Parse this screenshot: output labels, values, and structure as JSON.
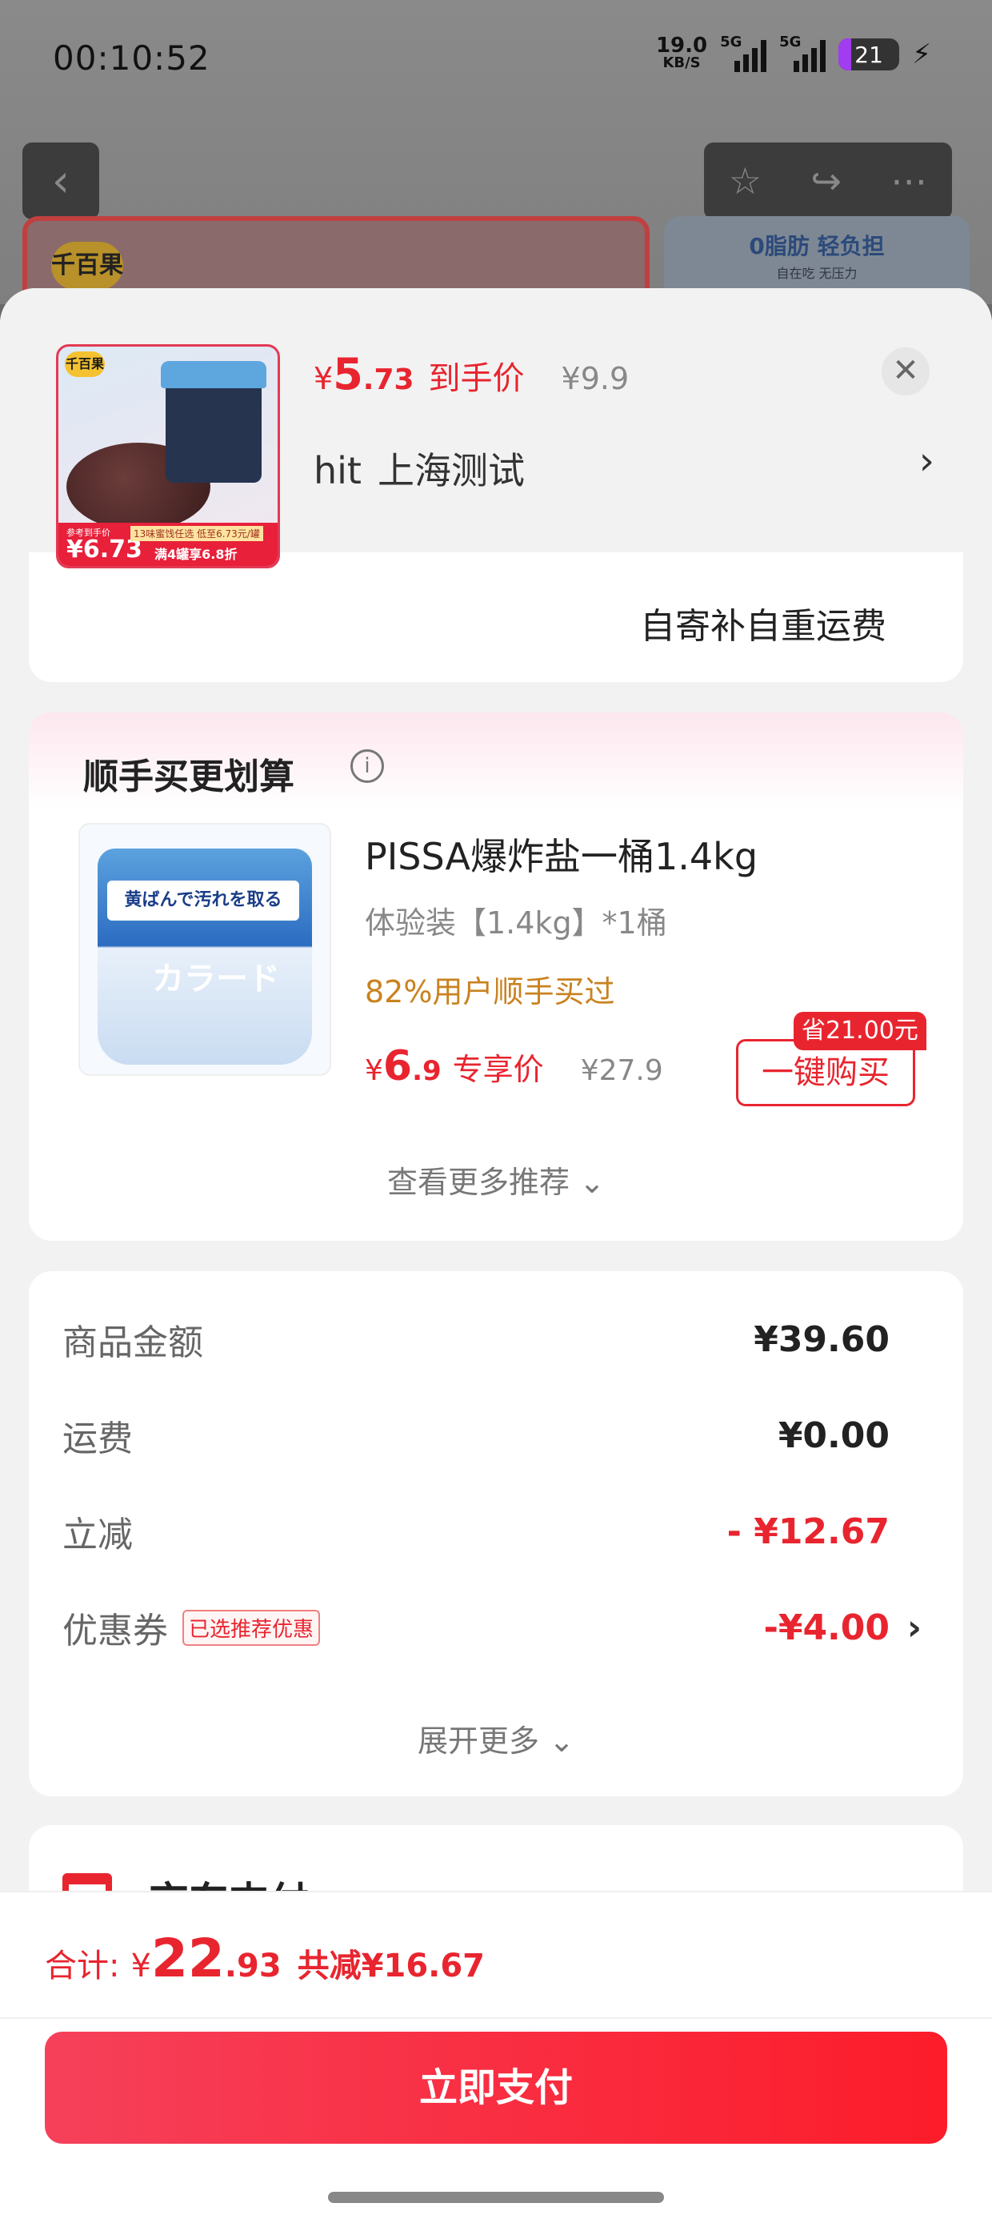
{
  "status_bar": {
    "time": "00:10:52",
    "net_speed": "19.0",
    "net_unit": "KB/S",
    "signal1": "5G",
    "signal2": "5G",
    "battery": "21"
  },
  "background": {
    "card_right_title": "0脂肪 轻负担",
    "card_right_sub": "自在吃 无压力",
    "logo": "千百果"
  },
  "sheet_header": {
    "price_currency": "¥",
    "price_int": "5",
    "price_dec": ".73",
    "price_label": "到手价",
    "orig_price": "¥9.9",
    "address_name": "hit",
    "address_region": "上海测试",
    "thumb_badge_label": "参考到手价",
    "thumb_badge_price": "¥6.73",
    "thumb_badge_small": "13味蜜饯任选 低至6.73元/罐",
    "thumb_badge_deal": "满4罐享6.8折"
  },
  "shipping_clip": "自寄补自重运费",
  "addon": {
    "title": "顺手买更划算",
    "product_name": "PISSA爆炸盐一桶1.4kg",
    "product_spec": "体验装【1.4kg】*1桶",
    "product_stat": "82%用户顺手买过",
    "price_currency": "¥",
    "price_int": "6",
    "price_dec": ".9",
    "price_label": "专享价",
    "orig_price": "¥27.9",
    "save_tag": "省21.00元",
    "buy_label": "一键购买",
    "more_label": "查看更多推荐",
    "img_text": "黄ばんで汚れを取る",
    "img_big": "カラード"
  },
  "summary": {
    "rows": [
      {
        "label": "商品金额",
        "value": "¥39.60"
      },
      {
        "label": "运费",
        "value": "¥0.00"
      },
      {
        "label": "立减",
        "value": "- ¥12.67"
      },
      {
        "label": "优惠券",
        "value": "-¥4.00",
        "tag": "已选推荐优惠"
      }
    ],
    "expand_label": "展开更多"
  },
  "payment": {
    "method": "京东支付"
  },
  "footer": {
    "total_label": "合计:",
    "total_currency": "¥",
    "total_int": "22",
    "total_dec": ".93",
    "total_save": "共减¥16.67",
    "pay_button": "立即支付"
  },
  "colors": {
    "accent_red": "#e8252f",
    "gold": "#c9821f"
  }
}
